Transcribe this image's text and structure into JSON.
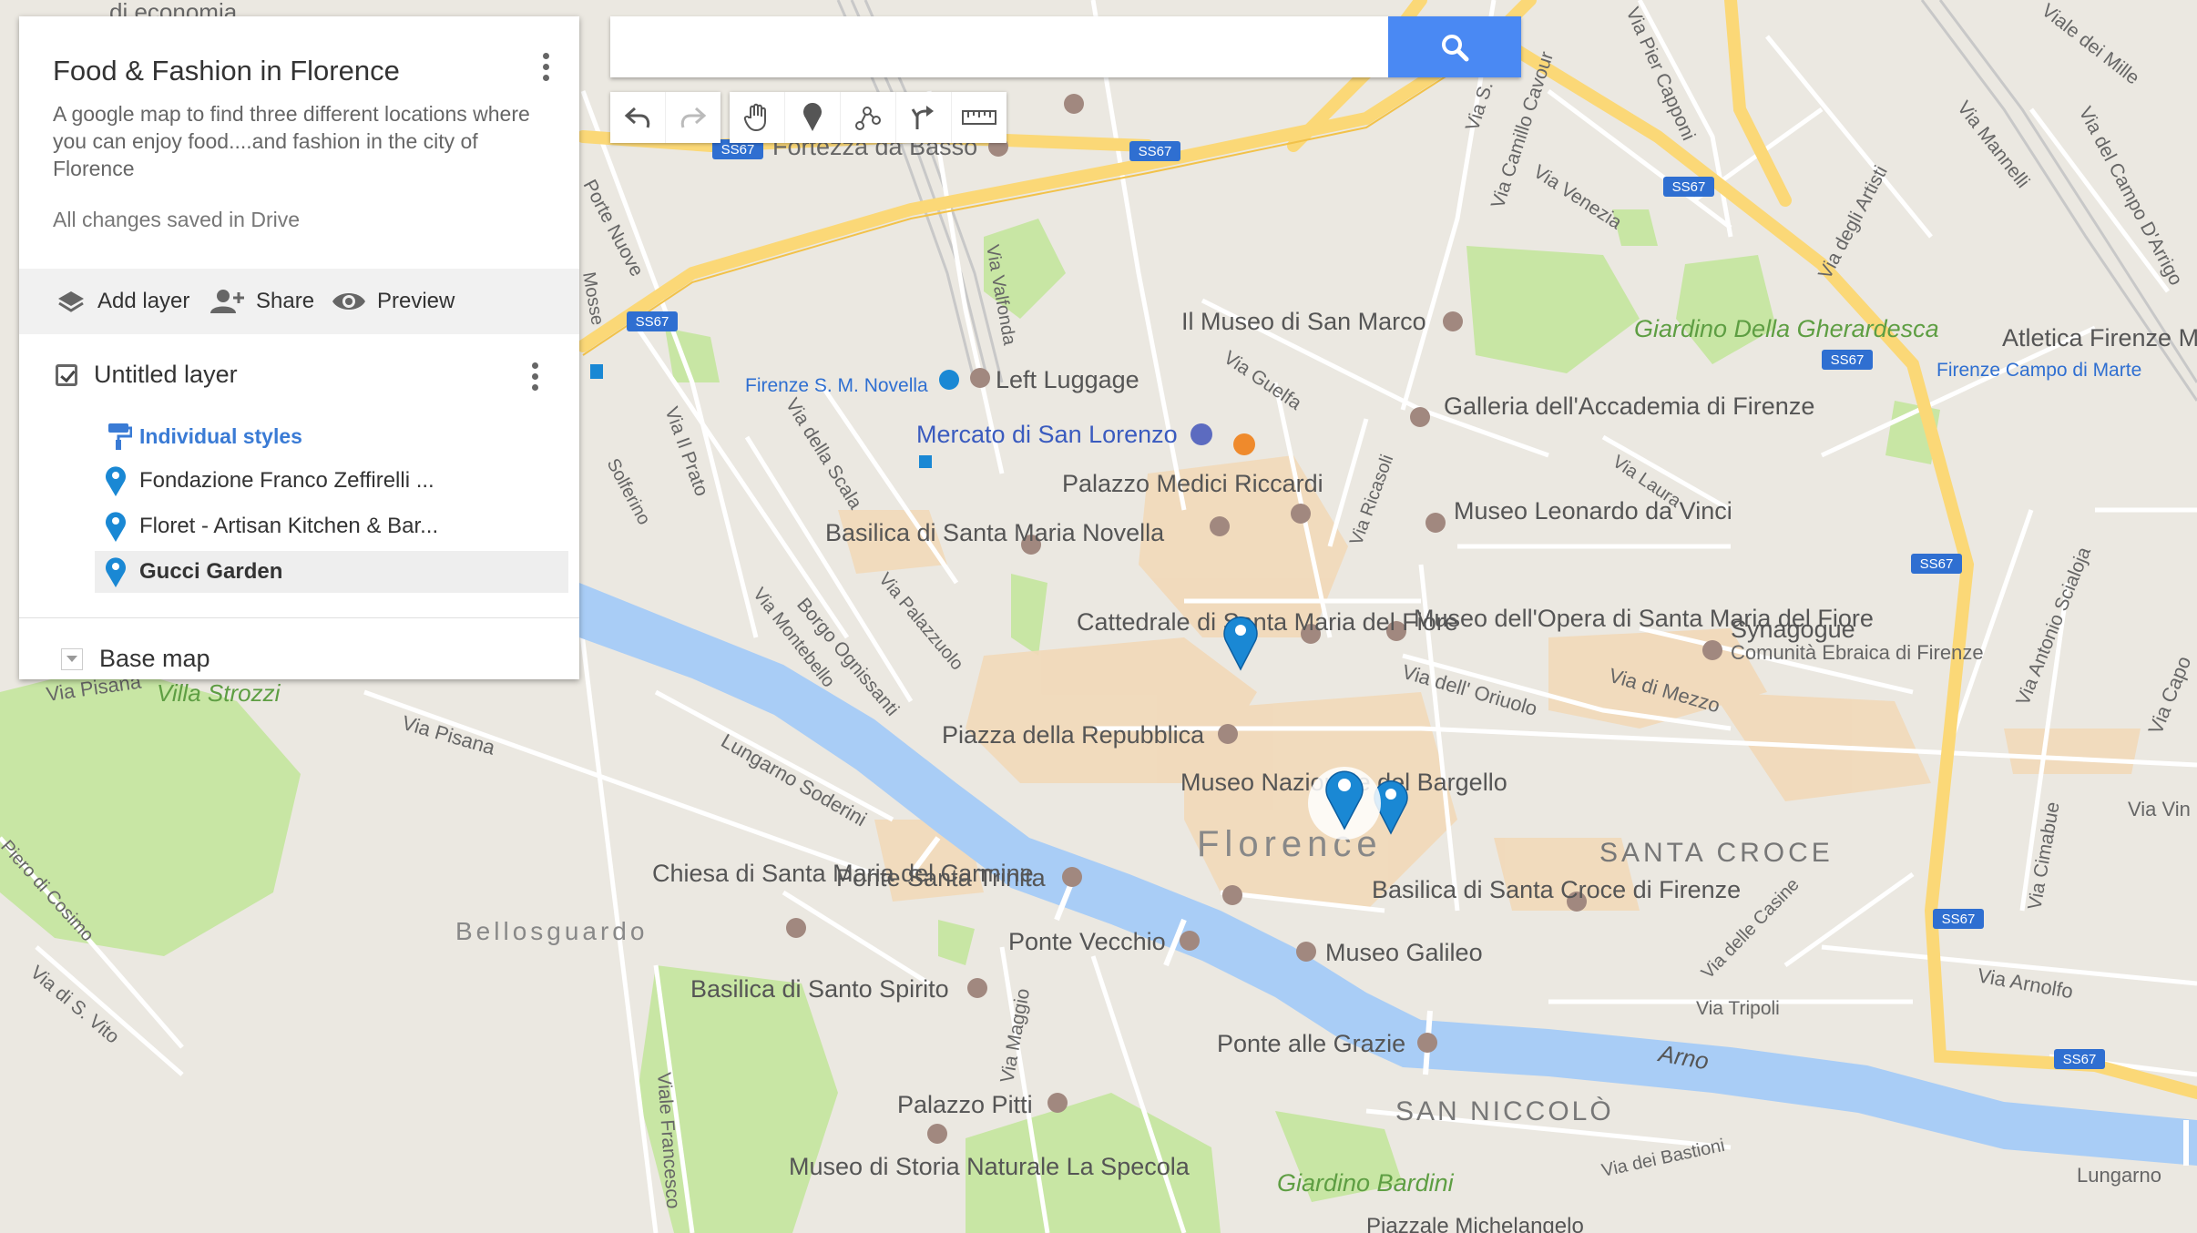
{
  "panel": {
    "title": "Food & Fashion in Florence",
    "description": "A google map to find three different locations where you can enjoy food....and fashion in the city of Florence",
    "saved_status": "All changes saved in Drive",
    "actions": {
      "add_layer": "Add layer",
      "share": "Share",
      "preview": "Preview"
    },
    "layer": {
      "name": "Untitled layer",
      "checked": true,
      "styles_label": "Individual styles",
      "items": [
        {
          "label": "Fondazione Franco Zeffirelli ..."
        },
        {
          "label": "Floret - Artisan Kitchen & Bar..."
        },
        {
          "label": "Gucci Garden",
          "selected": true
        }
      ]
    },
    "base_map_label": "Base map"
  },
  "search": {
    "placeholder": "",
    "value": ""
  },
  "toolbar": {
    "buttons": [
      "undo-icon",
      "redo-icon",
      "hand-icon",
      "marker-icon",
      "draw-line-icon",
      "directions-icon",
      "ruler-icon"
    ]
  },
  "colors": {
    "accent": "#4a89f3",
    "pin": "#1a88d4",
    "water": "#a9cdf6",
    "park": "#c8e6a4",
    "road_major": "#fbd877",
    "land": "#ebe8e1"
  },
  "map": {
    "labels": {
      "economia": "di economia",
      "fortezza": "Fortezza da Basso",
      "ss67": "SS67",
      "via_s_gallo": "Via S. Gallo",
      "via_camillo_cavour": "Via Camillo Cavour",
      "via_venezia": "Via Venezia",
      "via_pier_capponi": "Via Pier Capponi",
      "via_mannelli": "Via Mannelli",
      "via_dei_mille": "Viale dei Mille",
      "via_campo_darrigo": "Via del Campo D'Arrigo",
      "via_degli_artisti": "Via degli Artisti",
      "porte_nuove": "Porte Nuove",
      "via_valfonda": "Via Valfonda",
      "museo_san_marco": "Il Museo di San Marco",
      "giardino_gherardesca": "Giardino Della Gherardesca",
      "atletica": "Atletica Firenze M",
      "campo_di_marte": "Firenze Campo di Marte",
      "via_guelfa": "Via Guelfa",
      "smn": "Firenze S. M. Novella",
      "left_luggage": "Left Luggage",
      "galleria": "Galleria dell'Accademia di Firenze",
      "via_ricasoli": "Via Ricasoli",
      "via_laura": "Via Laura",
      "mercato": "Mercato di San Lorenzo",
      "via_il_prato": "Via Il Prato",
      "via_della_scala": "Via della Scala",
      "palazzo_medici": "Palazzo Medici Riccardi",
      "museo_leonardo": "Museo Leonardo da Vinci",
      "basilica_smn": "Basilica di Santa Maria Novella",
      "via_palazzuolo": "Via Palazzuolo",
      "borgo_ognissanti": "Borgo Ognissanti",
      "via_montebello": "Via Montebello",
      "cattedrale": "Cattedrale di Santa Maria del Fiore",
      "museo_opera": "Museo dell'Opera di Santa Maria del Fiore",
      "synagogue": "Synagogue",
      "comunita": "Comunità Ebraica di Firenze",
      "via_oriuolo": "Via dell' Oriuolo",
      "via_di_mezzo": "Via di Mezzo",
      "via_pisana": "Via Pisana",
      "villa_strozzi": "Villa Strozzi",
      "lungarno_soderini": "Lungarno Soderini",
      "piazza_repubblica": "Piazza della Repubblica",
      "museo_bargello": "Museo Nazionale del Bargello",
      "florence": "Florence",
      "santa_croce": "SANTA CROCE",
      "chiesa_carmine": "Chiesa di Santa Maria del Carmine",
      "ponte_trinita": "Ponte Santa Trinita",
      "bellosguardo": "Bellosguardo",
      "ponte_vecchio": "Ponte Vecchio",
      "basilica_croce": "Basilica di Santa Croce di Firenze",
      "museo_galileo": "Museo Galileo",
      "via_cimabue": "Via Cimabue",
      "via_arnolfo": "Via Arnolfo",
      "via_tripoli": "Via Tripoli",
      "via_antonio_scialoja": "Via Antonio Scialoja",
      "via_delle_casine": "Via delle Casine",
      "basilica_spirito": "Basilica di Santo Spirito",
      "via_maggio": "Via Maggio",
      "ponte_grazie": "Ponte alle Grazie",
      "arno": "Arno",
      "san_niccolo": "SAN NICCOLÒ",
      "palazzo_pitti": "Palazzo Pitti",
      "museo_specola": "Museo di Storia Naturale La Specola",
      "giardino_bardini": "Giardino Bardini",
      "via_dei_bastioni": "Via dei Bastioni",
      "lungarno": "Lungarno",
      "viale_francesco": "Viale Francesco",
      "via_s_vito": "Via di S. Vito",
      "piero_cosimo": "Piero di Cosimo",
      "colfiorino": "Solferino",
      "via_vin": "Via Vin",
      "via_capo": "Via Capo",
      "mosse": "Mosse",
      "piazzale": "Piazzale Michelangelo"
    }
  }
}
